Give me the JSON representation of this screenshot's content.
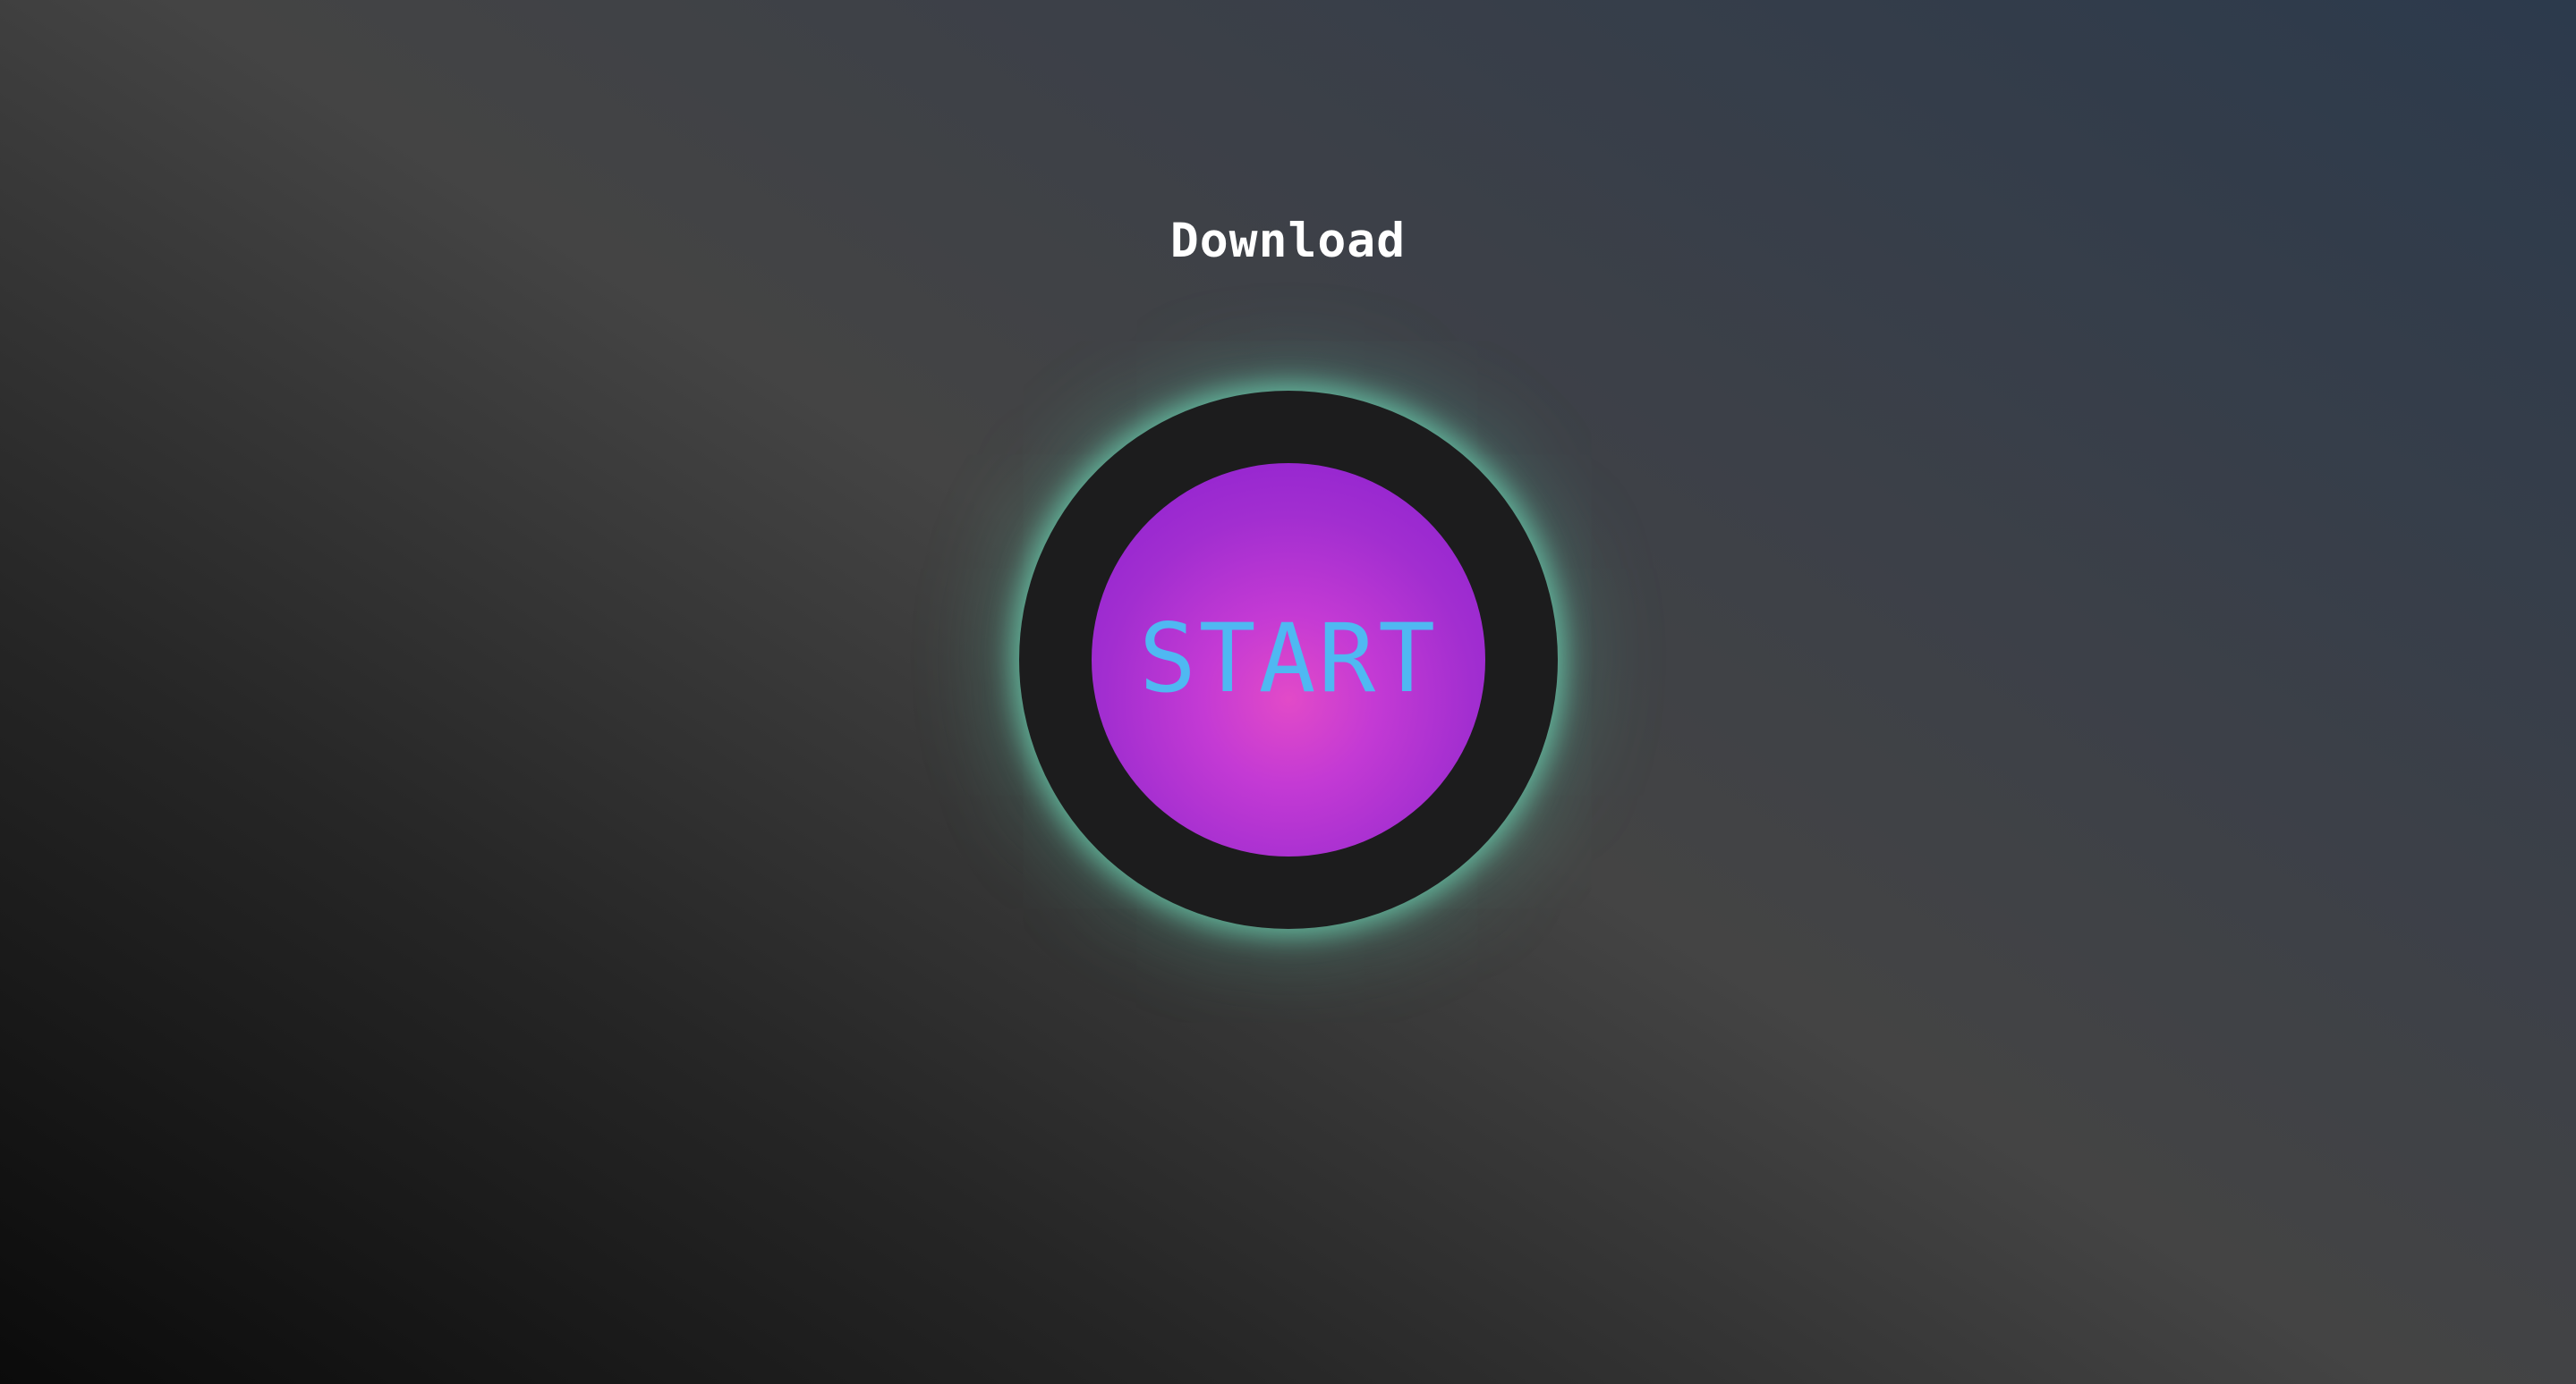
{
  "header": {
    "title": "Download"
  },
  "button": {
    "label": "START"
  },
  "colors": {
    "title": "#ffffff",
    "ring": "#1c1c1d",
    "glow": "#6ed6b4",
    "button_center": "#e24ac8",
    "button_edge": "#8a1fd0",
    "label": "#4fb8f2"
  }
}
